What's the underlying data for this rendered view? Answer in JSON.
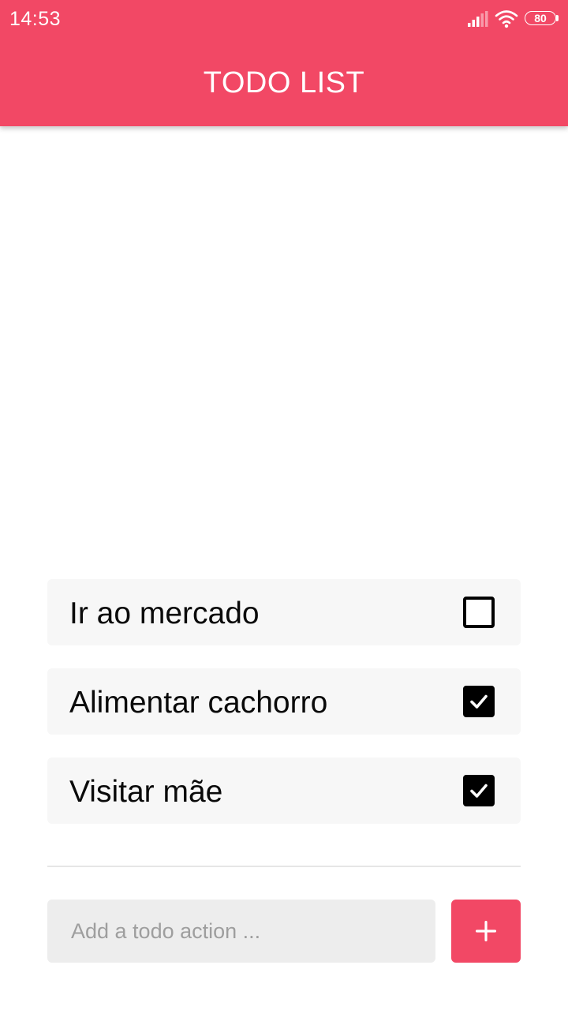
{
  "status_bar": {
    "time": "14:53",
    "battery": "80",
    "icons": [
      "signal-icon",
      "wifi-icon",
      "battery-icon"
    ]
  },
  "header": {
    "title": "TODO LIST"
  },
  "todos": [
    {
      "text": "Ir ao mercado",
      "checked": false
    },
    {
      "text": "Alimentar cachorro",
      "checked": true
    },
    {
      "text": "Visitar mãe",
      "checked": true
    }
  ],
  "add_form": {
    "placeholder": "Add a todo action ...",
    "value": "",
    "button_icon": "plus-icon"
  },
  "colors": {
    "accent": "#f24865",
    "item_background": "#f7f7f7",
    "input_background": "#ededed",
    "text": "#0a0a0a",
    "placeholder": "#9e9e9e"
  }
}
